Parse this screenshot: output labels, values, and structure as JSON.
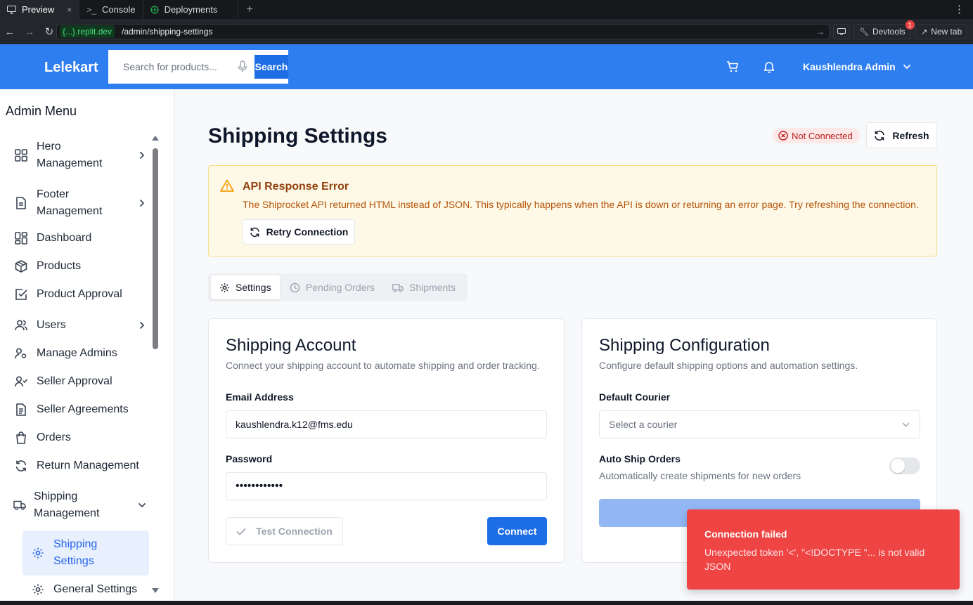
{
  "browser": {
    "tabs": [
      {
        "label": "Preview",
        "close": "×"
      },
      {
        "label": "Console"
      },
      {
        "label": "Deployments"
      }
    ],
    "new_tab_glyph": "+",
    "url_host": "{...}.replit.dev",
    "url_path": "/admin/shipping-settings",
    "devtools_label": "Devtools",
    "devtools_badge": "1",
    "newtab_label": "New tab"
  },
  "header": {
    "logo": "Lelekart",
    "search_placeholder": "Search for products...",
    "search_button": "Search",
    "user_name": "Kaushlendra Admin"
  },
  "sidebar": {
    "title": "Admin Menu",
    "items": [
      {
        "label": "Hero Management",
        "icon": "grid-icon",
        "chevron": "right"
      },
      {
        "label": "Footer Management",
        "icon": "file-icon",
        "chevron": "right"
      },
      {
        "label": "Dashboard",
        "icon": "dashboard-icon"
      },
      {
        "label": "Products",
        "icon": "package-icon"
      },
      {
        "label": "Product Approval",
        "icon": "check-square-icon"
      },
      {
        "label": "Users",
        "icon": "users-icon",
        "chevron": "right"
      },
      {
        "label": "Manage Admins",
        "icon": "user-cog-icon"
      },
      {
        "label": "Seller Approval",
        "icon": "user-check-icon"
      },
      {
        "label": "Seller Agreements",
        "icon": "file-text-icon"
      },
      {
        "label": "Orders",
        "icon": "shopping-bag-icon"
      },
      {
        "label": "Return Management",
        "icon": "refresh-icon"
      },
      {
        "label": "Shipping Management",
        "icon": "truck-icon",
        "chevron": "down"
      },
      {
        "label": "Shipping Settings",
        "icon": "settings-icon",
        "active": true
      },
      {
        "label": "General Settings",
        "icon": "settings-icon"
      }
    ]
  },
  "page": {
    "title": "Shipping Settings",
    "status": "Not Connected",
    "refresh": "Refresh",
    "alert": {
      "title": "API Response Error",
      "text": "The Shiprocket API returned HTML instead of JSON. This typically happens when the API is down or returning an error page. Try refreshing the connection.",
      "retry": "Retry Connection"
    },
    "tabs": [
      {
        "label": "Settings",
        "active": true
      },
      {
        "label": "Pending Orders"
      },
      {
        "label": "Shipments"
      }
    ],
    "account": {
      "title": "Shipping Account",
      "desc": "Connect your shipping account to automate shipping and order tracking.",
      "email_label": "Email Address",
      "email_value": "kaushlendra.k12@fms.edu",
      "password_label": "Password",
      "password_value": "••••••••••••",
      "test_button": "Test Connection",
      "connect_button": "Connect"
    },
    "config": {
      "title": "Shipping Configuration",
      "desc": "Configure default shipping options and automation settings.",
      "courier_label": "Default Courier",
      "courier_placeholder": "Select a courier",
      "auto_ship_label": "Auto Ship Orders",
      "auto_ship_desc": "Automatically create shipments for new orders",
      "auto_ship_enabled": false
    }
  },
  "toast": {
    "title": "Connection failed",
    "message": "Unexpected token '<', \"<!DOCTYPE \"... is not valid JSON"
  },
  "colors": {
    "brand": "#2f7ef0",
    "primary_button": "#1d6de5",
    "toast": "#ef4444",
    "alert_bg": "#fef9e7"
  }
}
